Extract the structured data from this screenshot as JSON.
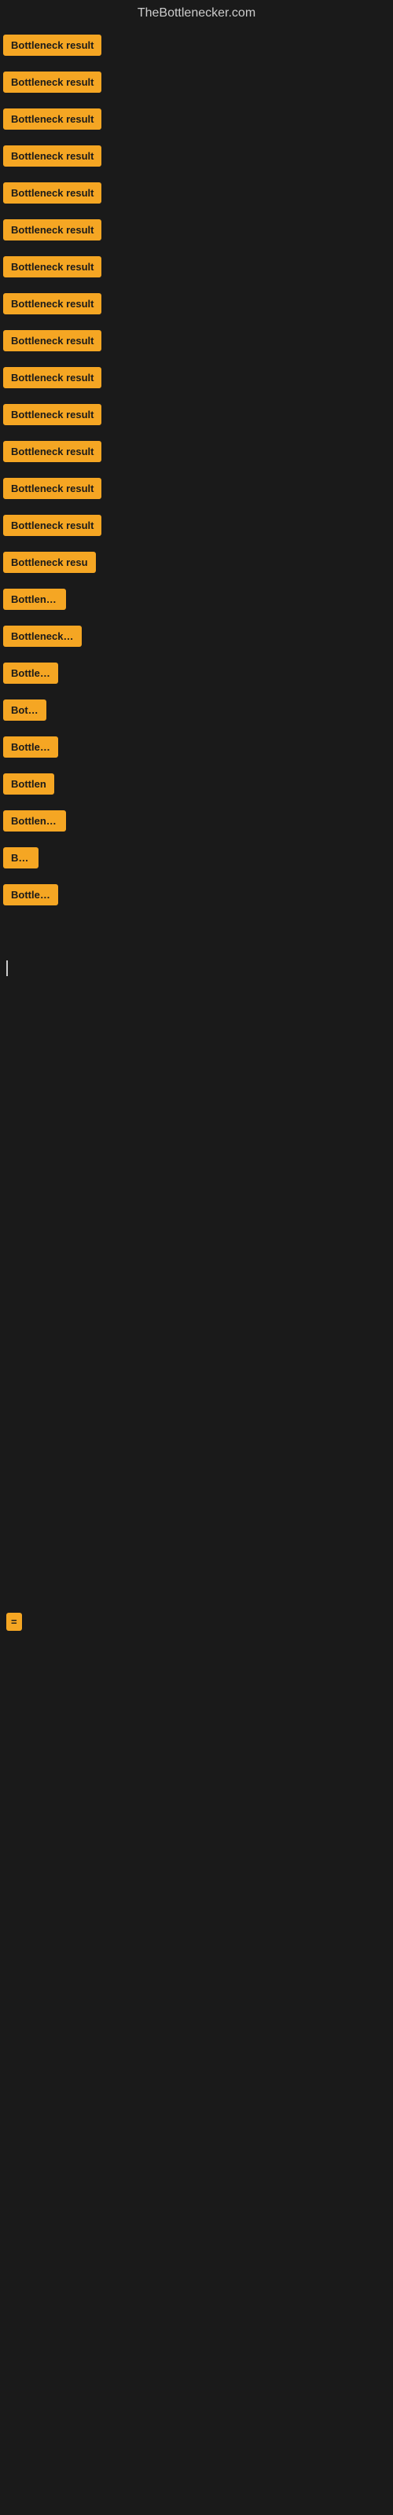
{
  "site": {
    "title": "TheBottlenecker.com"
  },
  "items": [
    {
      "id": 1,
      "label": "Bottleneck result",
      "width": "full"
    },
    {
      "id": 2,
      "label": "Bottleneck result",
      "width": "full"
    },
    {
      "id": 3,
      "label": "Bottleneck result",
      "width": "full"
    },
    {
      "id": 4,
      "label": "Bottleneck result",
      "width": "full"
    },
    {
      "id": 5,
      "label": "Bottleneck result",
      "width": "full"
    },
    {
      "id": 6,
      "label": "Bottleneck result",
      "width": "full"
    },
    {
      "id": 7,
      "label": "Bottleneck result",
      "width": "full"
    },
    {
      "id": 8,
      "label": "Bottleneck result",
      "width": "full"
    },
    {
      "id": 9,
      "label": "Bottleneck result",
      "width": "full"
    },
    {
      "id": 10,
      "label": "Bottleneck result",
      "width": "full"
    },
    {
      "id": 11,
      "label": "Bottleneck result",
      "width": "full"
    },
    {
      "id": 12,
      "label": "Bottleneck result",
      "width": "full"
    },
    {
      "id": 13,
      "label": "Bottleneck result",
      "width": "full"
    },
    {
      "id": 14,
      "label": "Bottleneck result",
      "width": "full"
    },
    {
      "id": 15,
      "label": "Bottleneck resu",
      "width": "partial1"
    },
    {
      "id": 16,
      "label": "Bottleneck",
      "width": "partial2"
    },
    {
      "id": 17,
      "label": "Bottleneck re",
      "width": "partial3"
    },
    {
      "id": 18,
      "label": "Bottlene",
      "width": "partial4"
    },
    {
      "id": 19,
      "label": "Bottle",
      "width": "partial5"
    },
    {
      "id": 20,
      "label": "Bottlene",
      "width": "partial4"
    },
    {
      "id": 21,
      "label": "Bottlen",
      "width": "partial6"
    },
    {
      "id": 22,
      "label": "Bottleneck",
      "width": "partial2"
    },
    {
      "id": 23,
      "label": "Bott",
      "width": "partial7"
    },
    {
      "id": 24,
      "label": "Bottlene",
      "width": "partial4"
    }
  ],
  "footer": {
    "cursor_visible": true,
    "small_badge_label": "="
  }
}
